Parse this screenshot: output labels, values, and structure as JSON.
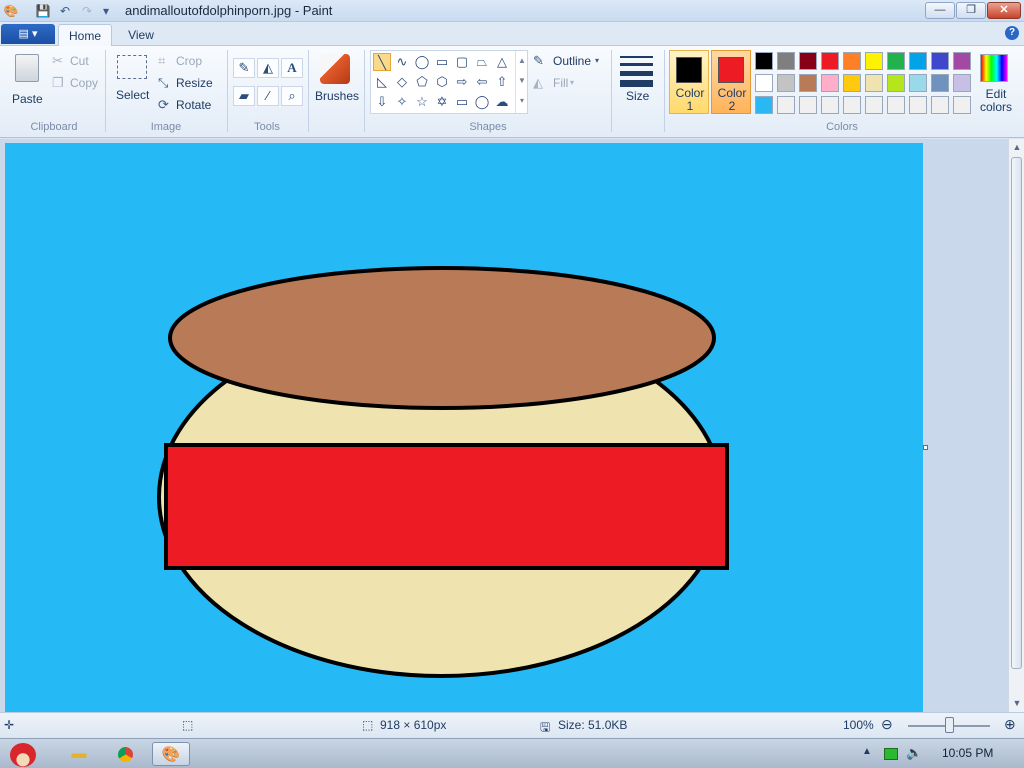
{
  "window": {
    "title": "andimalloutofdolphinporn.jpg - Paint",
    "minimize": "—",
    "maximize": "❐",
    "close": "✕"
  },
  "quick_access": {
    "app_icon": "🎨",
    "save_icon": "💾",
    "undo_icon": "↶",
    "redo_icon": "↷",
    "customize_icon": "▾"
  },
  "tabs": {
    "app_menu": "▤ ▾",
    "home": "Home",
    "view": "View",
    "help": "?"
  },
  "ribbon": {
    "clipboard": {
      "paste": "Paste",
      "cut": "Cut",
      "copy": "Copy",
      "label": "Clipboard"
    },
    "image": {
      "select": "Select",
      "crop": "Crop",
      "resize": "Resize",
      "rotate": "Rotate",
      "label": "Image"
    },
    "tools": {
      "label": "Tools"
    },
    "brushes": {
      "label": "Brushes"
    },
    "shapes": {
      "outline": "Outline",
      "fill": "Fill",
      "label": "Shapes"
    },
    "size": {
      "label": "Size"
    },
    "colors": {
      "color1_label": "Color 1",
      "color1_value": "#000000",
      "color2_label": "Color 2",
      "color2_value": "#ed1c24",
      "edit": "Edit colors",
      "label": "Colors",
      "palette_row1": [
        "#000000",
        "#7f7f7f",
        "#880015",
        "#ed1c24",
        "#ff7f27",
        "#fff200",
        "#22b14c",
        "#00a2e8",
        "#3f48cc",
        "#a349a4"
      ],
      "palette_row2": [
        "#ffffff",
        "#c3c3c3",
        "#b97a57",
        "#ffaec9",
        "#ffc90e",
        "#efe4b0",
        "#b5e61d",
        "#99d9ea",
        "#7092be",
        "#c8bfe7"
      ],
      "palette_row3": [
        "#2ab8f5",
        "#f0f0f0",
        "#f0f0f0",
        "#f0f0f0",
        "#f0f0f0",
        "#f0f0f0",
        "#f0f0f0",
        "#f0f0f0",
        "#f0f0f0",
        "#f0f0f0"
      ]
    }
  },
  "canvas": {
    "background": "#25b9f6",
    "lid_color": "#b97a57",
    "body_color": "#efe4b0",
    "band_color": "#ed1c24"
  },
  "status": {
    "dimensions": "918 × 610px",
    "size": "Size: 51.0KB",
    "zoom": "100%"
  },
  "taskbar": {
    "clock": "10:05 PM"
  }
}
